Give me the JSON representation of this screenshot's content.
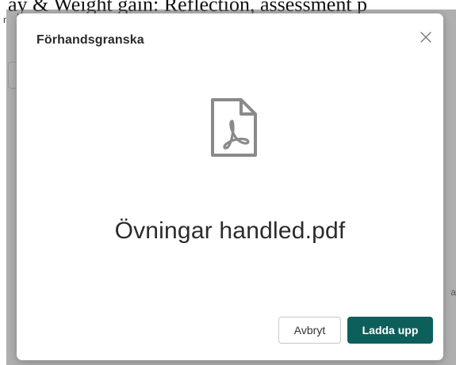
{
  "background": {
    "top_text": "ay & Weight gain: Reflection, assessment p",
    "corner_text": "r",
    "right_text": "a"
  },
  "modal": {
    "title": "Förhandsgranska",
    "close_icon": "close-icon",
    "file_icon": "pdf-file-icon",
    "file_name": "Övningar handled.pdf",
    "cancel_label": "Avbryt",
    "upload_label": "Ladda upp"
  },
  "colors": {
    "primary": "#0d5f5c",
    "overlay": "rgba(110,110,110,0.55)",
    "icon_gray": "#8a8a8a"
  }
}
